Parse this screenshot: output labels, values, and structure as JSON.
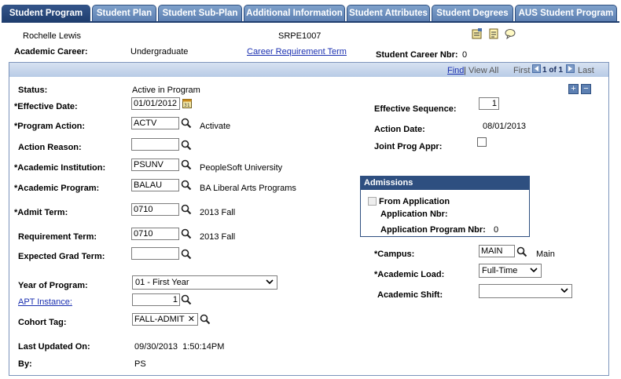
{
  "tabs": [
    {
      "label": "Student Program",
      "active": true
    },
    {
      "label": "Student Plan",
      "active": false
    },
    {
      "label": "Student Sub-Plan",
      "active": false
    },
    {
      "label": "Additional Information",
      "active": false
    },
    {
      "label": "Student Attributes",
      "active": false
    },
    {
      "label": "Student Degrees",
      "active": false
    },
    {
      "label": "AUS Student Program",
      "active": false
    }
  ],
  "header": {
    "student_name": "Rochelle Lewis",
    "student_id": "SRPE1007",
    "academic_career_label": "Academic Career:",
    "academic_career_value": "Undergraduate",
    "career_requirement_link": "Career Requirement Term",
    "student_career_nbr_label": "Student Career Nbr:",
    "student_career_nbr_value": "0"
  },
  "grid_nav": {
    "find": "Find",
    "separator": "|",
    "view_all": "View All",
    "first": "First",
    "range": "1 of 1",
    "last": "Last"
  },
  "form": {
    "status_label": "Status:",
    "status_value": "Active in Program",
    "effective_date_label": "*Effective Date:",
    "effective_date_value": "01/01/2012",
    "program_action_label": "*Program Action:",
    "program_action_value": "ACTV",
    "program_action_desc": "Activate",
    "action_reason_label": "Action Reason:",
    "action_reason_value": "",
    "academic_institution_label": "*Academic Institution:",
    "academic_institution_value": "PSUNV",
    "academic_institution_desc": "PeopleSoft University",
    "academic_program_label": "*Academic Program:",
    "academic_program_value": "BALAU",
    "academic_program_desc": "BA Liberal Arts Programs",
    "admit_term_label": "*Admit Term:",
    "admit_term_value": "0710",
    "admit_term_desc": "2013 Fall",
    "requirement_term_label": "Requirement Term:",
    "requirement_term_value": "0710",
    "requirement_term_desc": "2013 Fall",
    "expected_grad_term_label": "Expected Grad Term:",
    "expected_grad_term_value": "",
    "year_of_program_label": "Year of Program:",
    "year_of_program_value": "01 - First Year",
    "apt_instance_label": "APT Instance:",
    "apt_instance_value": "1",
    "cohort_tag_label": "Cohort Tag:",
    "cohort_tag_value": "FALL-ADMIT",
    "last_updated_label": "Last Updated On:",
    "last_updated_value": "09/30/2013  1:50:14PM",
    "by_label": "By:",
    "by_value": "PS",
    "effective_sequence_label": "Effective Sequence:",
    "effective_sequence_value": "1",
    "action_date_label": "Action Date:",
    "action_date_value": "08/01/2013",
    "joint_prog_label": "Joint Prog Appr:",
    "campus_label": "*Campus:",
    "campus_value": "MAIN",
    "campus_desc": "Main",
    "academic_load_label": "*Academic Load:",
    "academic_load_value": "Full-Time",
    "academic_shift_label": "Academic Shift:",
    "academic_shift_value": ""
  },
  "admissions": {
    "title": "Admissions",
    "from_application_label": "From Application",
    "application_nbr_label": "Application Nbr:",
    "application_program_nbr_label": "Application Program Nbr:",
    "application_program_nbr_value": "0"
  },
  "colors": {
    "tab_active": "#1f3d6e",
    "tab": "#6a8cbc",
    "link": "#1a2fb0",
    "frame_header": "#c7d6ec"
  }
}
